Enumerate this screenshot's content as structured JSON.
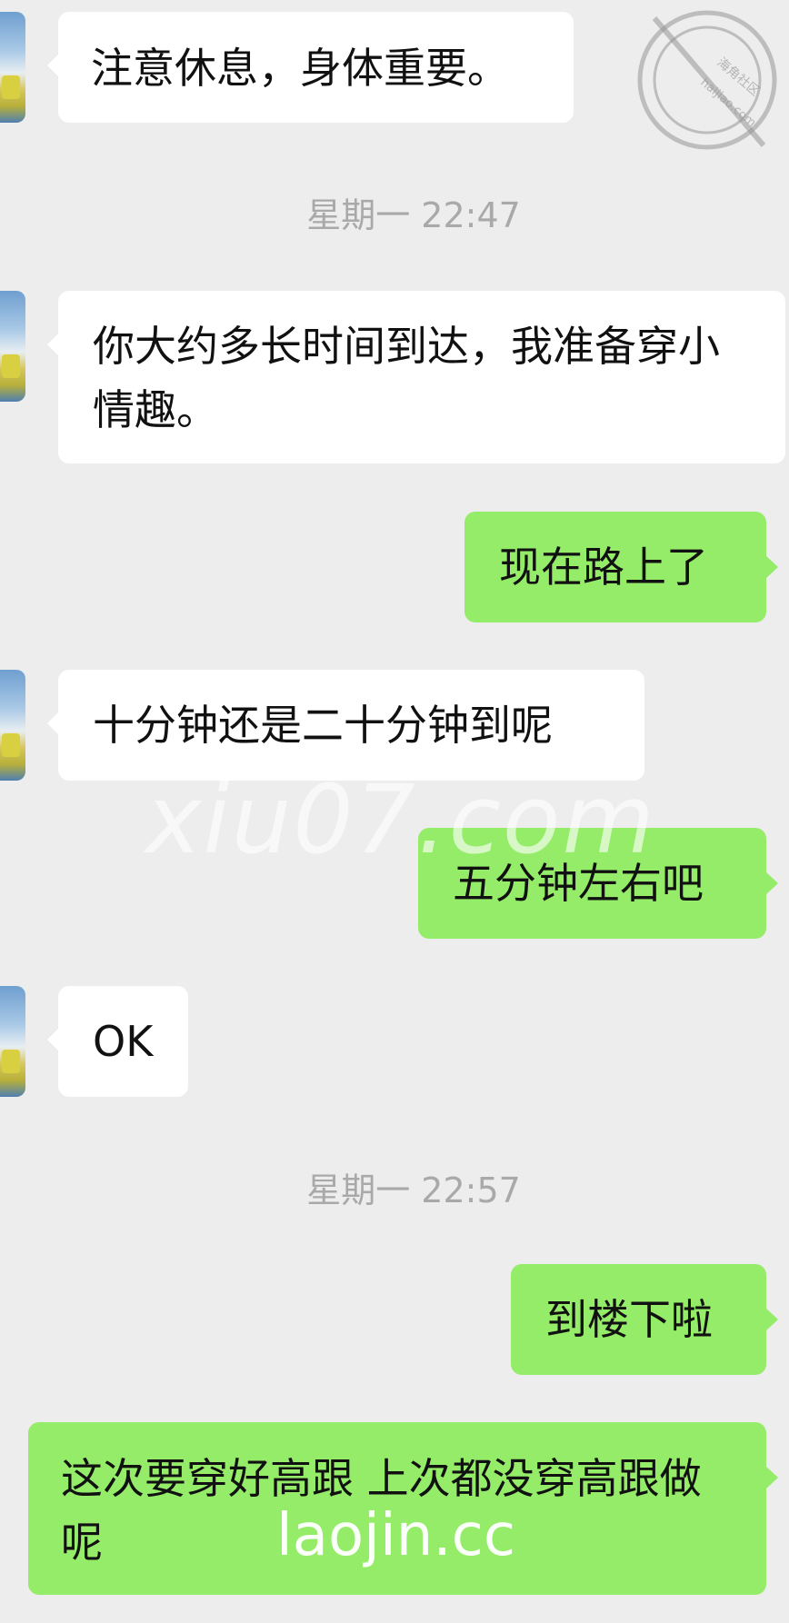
{
  "messages": [
    {
      "side": "in",
      "text": "注意休息，身体重要。"
    },
    {
      "side": "time",
      "text": "星期一 22:47"
    },
    {
      "side": "in",
      "text": "你大约多长时间到达，我准备穿小情趣。"
    },
    {
      "side": "out",
      "text": "现在路上了"
    },
    {
      "side": "in",
      "text": "十分钟还是二十分钟到呢"
    },
    {
      "side": "out",
      "text": "五分钟左右吧"
    },
    {
      "side": "in",
      "text": "OK"
    },
    {
      "side": "time",
      "text": "星期一 22:57"
    },
    {
      "side": "out",
      "text": "到楼下啦"
    },
    {
      "side": "out",
      "text": "这次要穿好高跟 上次都没穿高跟做呢"
    }
  ],
  "watermarks": {
    "center": "xiu07.com",
    "bottom": "laojin.cc",
    "seal": "hailiao.com 海角社区"
  }
}
